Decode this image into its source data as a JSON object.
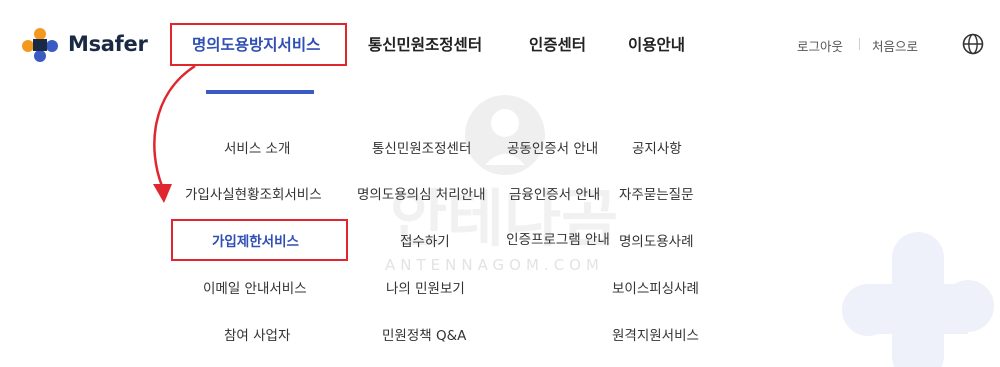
{
  "brand": {
    "name": "Msafer"
  },
  "nav": {
    "items": [
      {
        "label": "명의도용방지서비스",
        "active": true
      },
      {
        "label": "통신민원조정센터",
        "active": false
      },
      {
        "label": "인증센터",
        "active": false
      },
      {
        "label": "이용안내",
        "active": false
      }
    ]
  },
  "utility": {
    "logout": "로그아웃",
    "home": "처음으로",
    "language_icon": "globe-icon"
  },
  "submenu": {
    "col1": [
      "서비스 소개",
      "가입사실현황조회서비스",
      "가입제한서비스",
      "이메일 안내서비스",
      "참여 사업자"
    ],
    "col2": [
      "통신민원조정센터",
      "명의도용의심 처리안내",
      "접수하기",
      "나의 민원보기",
      "민원정책 Q&A"
    ],
    "col3": [
      "공동인증서 안내",
      "금융인증서 안내",
      "인증프로그램 안내"
    ],
    "col4": [
      "공지사항",
      "자주묻는질문",
      "명의도용사례",
      "보이스피싱사례",
      "원격지원서비스"
    ]
  },
  "watermark": {
    "text": "ANTENNAGOM.COM"
  },
  "colors": {
    "accent": "#2f4fb4",
    "highlight": "#e0262e",
    "logo_orange": "#f39a1e",
    "logo_navy": "#1b2a44"
  }
}
